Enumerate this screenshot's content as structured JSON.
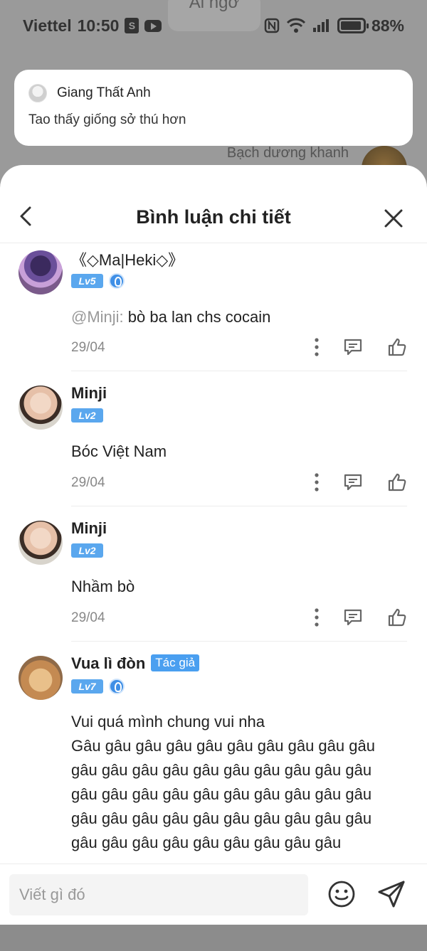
{
  "background": {
    "title": "Ai ngờ",
    "user_name": "Bạch dương khanh"
  },
  "status_bar": {
    "carrier": "Viettel",
    "time": "10:50",
    "battery": "88%"
  },
  "notification": {
    "sender": "Giang Thất Anh",
    "message": "Tao thấy giống sở thú hơn"
  },
  "sheet": {
    "title": "Bình luận chi tiết"
  },
  "comments": [
    {
      "name": "《◇Ma|Heki◇》",
      "level": "Lv5",
      "mention": "@Minji:",
      "text": " bò ba lan chs cocain",
      "date": "29/04"
    },
    {
      "name": "Minji",
      "level": "Lv2",
      "text": "Bóc Việt Nam",
      "date": "29/04"
    },
    {
      "name": "Minji",
      "level": "Lv2",
      "text": "Nhầm bò",
      "date": "29/04"
    },
    {
      "name": "Vua lì đòn",
      "author_tag": "Tác giả",
      "level": "Lv7",
      "text_lines": [
        "Vui quá mình chung vui nha",
        "Gâu gâu gâu gâu gâu gâu gâu gâu gâu gâu",
        "gâu gâu gâu gâu gâu gâu gâu gâu gâu gâu",
        "gâu gâu gâu gâu gâu gâu gâu gâu gâu gâu",
        "gâu gâu gâu gâu gâu gâu gâu gâu gâu gâu",
        "gâu gâu gâu gâu gâu gâu gâu gâu gâu"
      ]
    }
  ],
  "input": {
    "placeholder": "Viết gì đó"
  },
  "icons": {
    "back": "chevron-left-icon",
    "close": "close-icon",
    "more": "more-vertical-icon",
    "reply": "comment-icon",
    "like": "thumbs-up-icon",
    "emoji": "smile-icon",
    "send": "send-icon"
  }
}
